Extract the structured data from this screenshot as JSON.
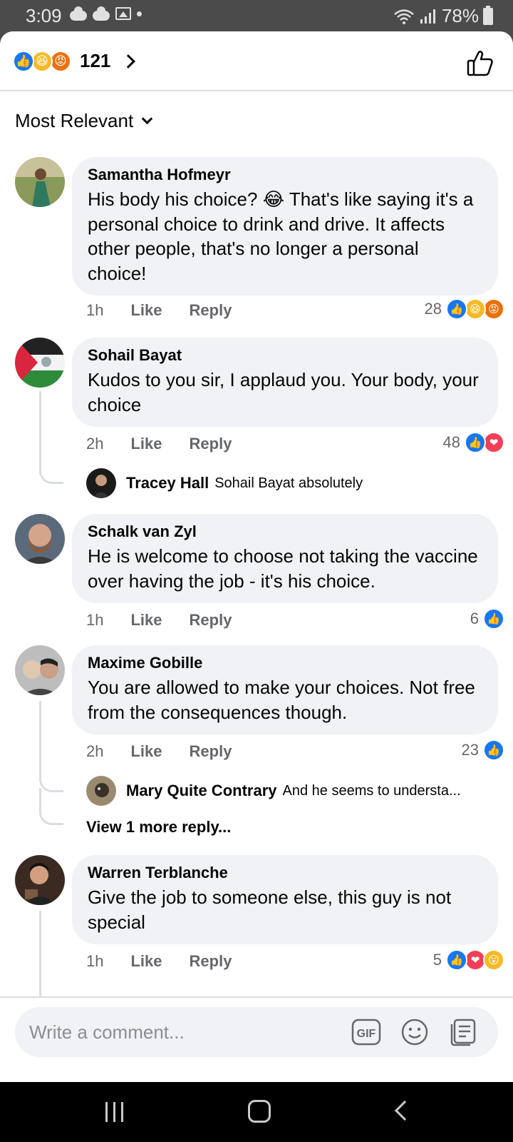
{
  "status_bar": {
    "time": "3:09",
    "battery": "78%"
  },
  "header": {
    "reaction_count": "121"
  },
  "sort": {
    "label": "Most Relevant"
  },
  "comments": [
    {
      "name": "Samantha Hofmeyr",
      "text_before_emoji": "His body his choice? ",
      "emoji": "😂",
      "text_after_emoji": " That's like saying it's a personal choice to drink and drive. It affects other people, that's no longer a personal choice!",
      "time": "1h",
      "like": "Like",
      "reply": "Reply",
      "reaction_count": "28",
      "reactions": [
        "like",
        "haha",
        "angry"
      ]
    },
    {
      "name": "Sohail Bayat",
      "text": "Kudos to you sir, I applaud you. Your body, your choice",
      "time": "2h",
      "like": "Like",
      "reply": "Reply",
      "reaction_count": "48",
      "reactions": [
        "like",
        "love"
      ],
      "reply_preview": {
        "name": "Tracey Hall",
        "text": "Sohail Bayat absolutely"
      }
    },
    {
      "name": "Schalk van Zyl",
      "text": "He is welcome to choose not taking the vaccine over having the job - it's his choice.",
      "time": "1h",
      "like": "Like",
      "reply": "Reply",
      "reaction_count": "6",
      "reactions": [
        "like"
      ]
    },
    {
      "name": "Maxime Gobille",
      "text": "You are allowed to make your choices. Not free from the consequences though.",
      "time": "2h",
      "like": "Like",
      "reply": "Reply",
      "reaction_count": "23",
      "reactions": [
        "like"
      ],
      "reply_preview": {
        "name": "Mary Quite Contrary",
        "text": "And he seems to understa..."
      },
      "more_replies": "View 1 more reply..."
    },
    {
      "name": "Warren Terblanche",
      "text": "Give the job to someone else, this guy is not special",
      "time": "1h",
      "like": "Like",
      "reply": "Reply",
      "reaction_count": "5",
      "reactions": [
        "like",
        "love",
        "wow"
      ]
    }
  ],
  "composer": {
    "placeholder": "Write a comment...",
    "gif_label": "GIF"
  },
  "colors": {
    "like": "#1877f2",
    "love": "#f33e58",
    "haha": "#f7b928",
    "angry": "#e9710f",
    "bubble": "#f0f2f5",
    "secondary_text": "#65676b"
  }
}
